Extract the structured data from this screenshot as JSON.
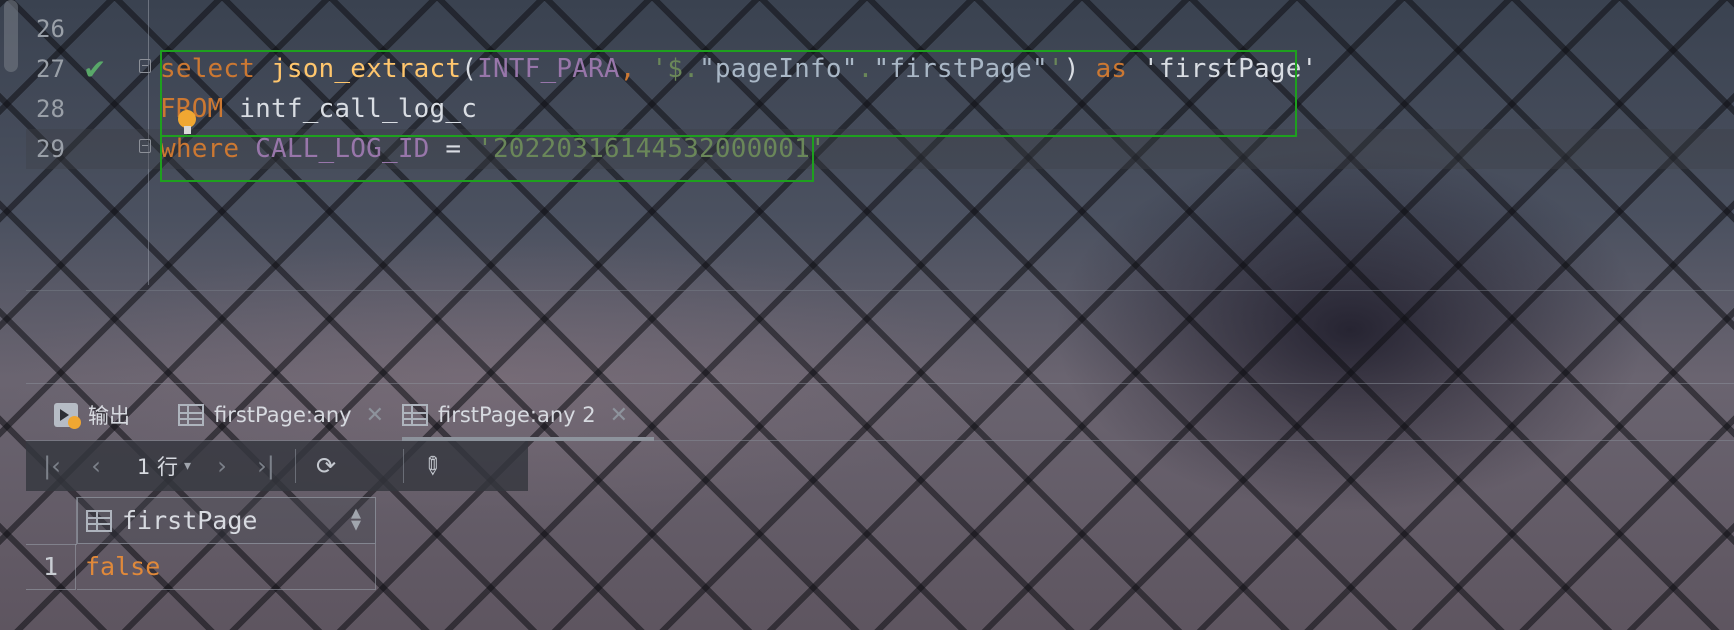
{
  "editor": {
    "lines": [
      {
        "number": "26"
      },
      {
        "number": "27",
        "status": "check-icon"
      },
      {
        "number": "28"
      },
      {
        "number": "29"
      }
    ],
    "code": {
      "l27": {
        "kw_select": "select",
        "fn": "json_extract",
        "open_paren": "(",
        "ident": "INTF_PARA",
        "comma": ", ",
        "str_a": "'$.",
        "str_b": "\"pageInfo\"",
        "str_c": ".",
        "str_d": "\"firstPage\"",
        "str_e": "'",
        "close_paren": ") ",
        "kw_as": "as",
        "alias": " 'firstPage'"
      },
      "l28": {
        "kw_from": "FROM",
        "table": " intf_call_log_c"
      },
      "l29": {
        "kw_where": "where",
        "ident": " CALL_LOG_ID",
        "op": " = ",
        "str": "'20220316144532000001'"
      }
    }
  },
  "results": {
    "tabs": [
      {
        "label": "输出",
        "icon": "output-icon",
        "closable": false,
        "active": false
      },
      {
        "label": "firstPage:any",
        "icon": "table-icon",
        "closable": true,
        "active": false
      },
      {
        "label": "firstPage:any 2",
        "icon": "table-icon",
        "closable": true,
        "active": true
      }
    ],
    "close_glyph": "✕",
    "toolbar": {
      "first": "first-page-icon",
      "prev": "prev-page-icon",
      "rows_label": "1 行",
      "next": "next-page-icon",
      "last": "last-page-icon",
      "refresh": "refresh-icon",
      "pin": "pin-icon"
    },
    "table": {
      "columns": [
        "firstPage"
      ],
      "rows": [
        {
          "num": "1",
          "values": [
            "false"
          ]
        }
      ]
    }
  }
}
